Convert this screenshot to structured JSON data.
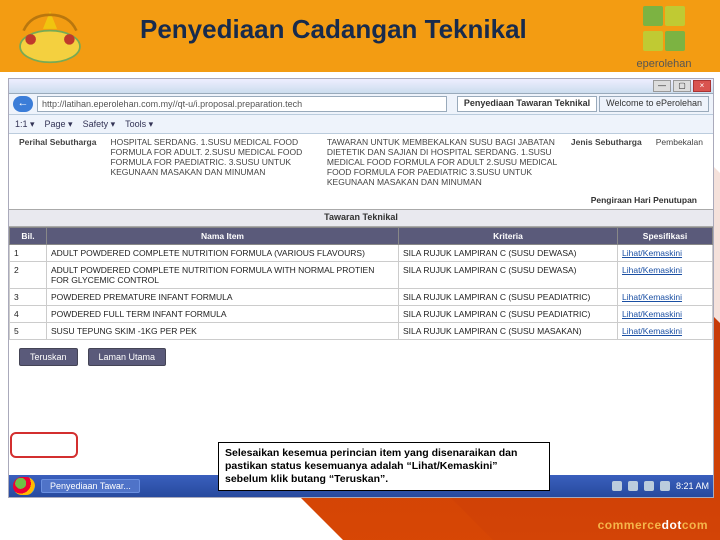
{
  "title": "Penyediaan Cadangan Teknikal",
  "logo_ep_text": "eperolehan",
  "footer_logo": {
    "a": "commerce",
    "b": "dot",
    "c": "com"
  },
  "browser": {
    "url": "http://latihan.eperolehan.com.my//qt-u/i.proposal.preparation.tech",
    "tabs": [
      {
        "label": "Penyediaan Tawaran Teknikal",
        "active": true
      },
      {
        "label": "Welcome to ePerolehan",
        "active": false
      }
    ],
    "toolbar": [
      "1:1 ▾",
      "Page ▾",
      "Safety ▾",
      "Tools ▾"
    ],
    "winbtns": [
      "—",
      "▢",
      "×"
    ]
  },
  "form": {
    "perihal_label": "Perihal Sebutharga",
    "perihal_value": "HOSPITAL SERDANG. 1.SUSU MEDICAL FOOD FORMULA FOR ADULT. 2.SUSU MEDICAL FOOD FORMULA FOR PAEDIATRIC. 3.SUSU UNTUK KEGUNAAN MASAKAN DAN MINUMAN",
    "tawaran_value": "TAWARAN UNTUK MEMBEKALKAN SUSU BAGI JABATAN DIETETIK DAN SAJIAN DI HOSPITAL SERDANG. 1.SUSU MEDICAL FOOD FORMULA FOR ADULT 2.SUSU MEDICAL FOOD FORMULA FOR PAEDIATRIC 3.SUSU UNTUK KEGUNAAN MASAKAN DAN MINUMAN",
    "jenis_label": "Jenis Sebutharga",
    "jenis_value": "Pembekalan",
    "closing": "Pengiraan Hari Penutupan",
    "section": "Tawaran Teknikal"
  },
  "table": {
    "headers": [
      "Bil.",
      "Nama Item",
      "Kriteria",
      "Spesifikasi"
    ],
    "rows": [
      {
        "n": "1",
        "item": "ADULT POWDERED COMPLETE NUTRITION FORMULA (VARIOUS FLAVOURS)",
        "krit": "SILA RUJUK LAMPIRAN C (SUSU DEWASA)",
        "spec": "Lihat/Kemaskini"
      },
      {
        "n": "2",
        "item": "ADULT POWDERED COMPLETE NUTRITION FORMULA WITH NORMAL PROTIEN FOR GLYCEMIC CONTROL",
        "krit": "SILA RUJUK LAMPIRAN C (SUSU DEWASA)",
        "spec": "Lihat/Kemaskini"
      },
      {
        "n": "3",
        "item": "POWDERED PREMATURE INFANT FORMULA",
        "krit": "SILA RUJUK LAMPIRAN C (SUSU PEADIATRIC)",
        "spec": "Lihat/Kemaskini"
      },
      {
        "n": "4",
        "item": "POWDERED FULL TERM INFANT FORMULA",
        "krit": "SILA RUJUK LAMPIRAN C (SUSU PEADIATRIC)",
        "spec": "Lihat/Kemaskini"
      },
      {
        "n": "5",
        "item": "SUSU TEPUNG SKIM -1KG PER PEK",
        "krit": "SILA RUJUK LAMPIRAN C (SUSU MASAKAN)",
        "spec": "Lihat/Kemaskini"
      }
    ]
  },
  "buttons": {
    "teruskan": "Teruskan",
    "laman": "Laman Utama"
  },
  "callout": "Selesaikan kesemua perincian item yang disenaraikan dan pastikan status kesemuanya adalah “Lihat/Kemaskini” sebelum klik butang “Teruskan”.",
  "taskbar": {
    "task": "Penyediaan Tawar...",
    "time": "8:21 AM"
  }
}
